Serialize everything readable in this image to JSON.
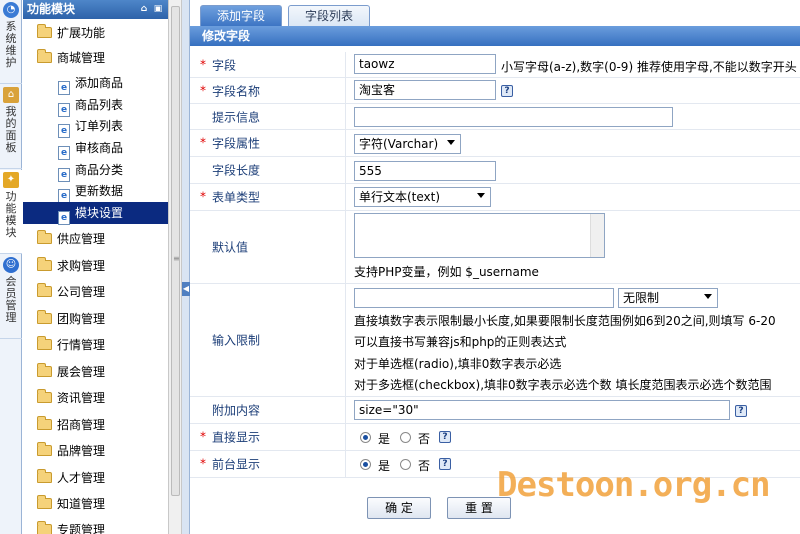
{
  "left_tabs": [
    {
      "label": "系统维护",
      "icon": "system-icon"
    },
    {
      "label": "我的面板",
      "icon": "home-icon"
    },
    {
      "label": "功能模块",
      "icon": "module-icon"
    },
    {
      "label": "会员管理",
      "icon": "member-icon"
    }
  ],
  "tree": {
    "title": "功能模块",
    "items": [
      {
        "label": "扩展功能",
        "type": "folder"
      },
      {
        "label": "商城管理",
        "type": "folder"
      },
      {
        "label": "添加商品",
        "type": "page"
      },
      {
        "label": "商品列表",
        "type": "page"
      },
      {
        "label": "订单列表",
        "type": "page"
      },
      {
        "label": "审核商品",
        "type": "page"
      },
      {
        "label": "商品分类",
        "type": "page"
      },
      {
        "label": "更新数据",
        "type": "page"
      },
      {
        "label": "模块设置",
        "type": "page",
        "selected": true
      },
      {
        "label": "供应管理",
        "type": "folder"
      },
      {
        "label": "求购管理",
        "type": "folder"
      },
      {
        "label": "公司管理",
        "type": "folder"
      },
      {
        "label": "团购管理",
        "type": "folder"
      },
      {
        "label": "行情管理",
        "type": "folder"
      },
      {
        "label": "展会管理",
        "type": "folder"
      },
      {
        "label": "资讯管理",
        "type": "folder"
      },
      {
        "label": "招商管理",
        "type": "folder"
      },
      {
        "label": "品牌管理",
        "type": "folder"
      },
      {
        "label": "人才管理",
        "type": "folder"
      },
      {
        "label": "知道管理",
        "type": "folder"
      },
      {
        "label": "专题管理",
        "type": "folder"
      }
    ]
  },
  "tabs": [
    {
      "label": "添加字段",
      "active": true
    },
    {
      "label": "字段列表",
      "active": false
    }
  ],
  "panel_title": "修改字段",
  "form": {
    "field_label": "字段",
    "field_value": "taowz",
    "field_note": "小写字母(a-z),数字(0-9) 推荐使用字母,不能以数字开头",
    "name_label": "字段名称",
    "name_value": "淘宝客",
    "hint_label": "提示信息",
    "hint_value": "",
    "attr_label": "字段属性",
    "attr_value": "字符(Varchar)",
    "length_label": "字段长度",
    "length_value": "555",
    "type_label": "表单类型",
    "type_value": "单行文本(text)",
    "default_label": "默认值",
    "default_value": "",
    "default_note": "支持PHP变量，例如 $_username",
    "limit_label": "输入限制",
    "limit_value": "",
    "limit_select": "无限制",
    "limit_notes": [
      "直接填数字表示限制最小长度,如果要限制长度范围例如6到20之间,则填写  6-20",
      "可以直接书写兼容js和php的正则表达式",
      "对于单选框(radio),填非0数字表示必选",
      "对于多选框(checkbox),填非0数字表示必选个数 填长度范围表示必选个数范围"
    ],
    "extra_label": "附加内容",
    "extra_value": "size=\"30\"",
    "direct_label": "直接显示",
    "front_label": "前台显示",
    "yes": "是",
    "no": "否",
    "help_glyph": "?"
  },
  "buttons": {
    "confirm": "确 定",
    "reset": "重 置"
  },
  "watermark": "Destoon.org.cn"
}
